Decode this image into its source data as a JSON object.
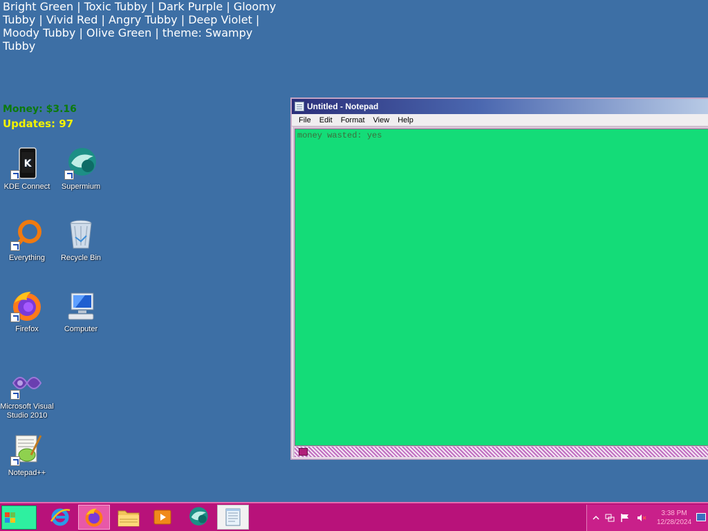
{
  "overlay": {
    "theme_line": "Bright Green | Toxic Tubby | Dark Purple | Gloomy Tubby | Vivid Red | Angry Tubby | Deep Violet | Moody Tubby | Olive Green | theme: Swampy Tubby",
    "money": "Money: $3.16",
    "updates": "Updates: 97"
  },
  "desktop": {
    "icons": [
      {
        "label": "KDE Connect",
        "icon": "kde-connect-icon"
      },
      {
        "label": "Supermium",
        "icon": "supermium-icon"
      },
      {
        "label": "Everything",
        "icon": "everything-icon"
      },
      {
        "label": "Recycle Bin",
        "icon": "recycle-bin-icon"
      },
      {
        "label": "Firefox",
        "icon": "firefox-icon"
      },
      {
        "label": "Computer",
        "icon": "computer-icon"
      },
      {
        "label": "Microsoft Visual Studio 2010",
        "icon": "visual-studio-icon"
      },
      {
        "label": "Notepad++",
        "icon": "notepad-plus-plus-icon"
      }
    ]
  },
  "notepad": {
    "title": "Untitled - Notepad",
    "menu": [
      "File",
      "Edit",
      "Format",
      "View",
      "Help"
    ],
    "content": "money wasted: yes"
  },
  "taskbar": {
    "items": [
      "internet-explorer-icon",
      "firefox-icon",
      "file-explorer-icon",
      "media-player-icon",
      "supermium-icon",
      "notepad-icon"
    ],
    "active": "firefox-icon",
    "clock_time": "3:38 PM",
    "clock_date": "12/28/2024"
  },
  "colors": {
    "desktop_bg": "#3d6fa5",
    "taskbar_bg": "#b8127a",
    "notepad_bg": "#14dc78",
    "money_text": "#0c7a0c",
    "updates_text": "#f2f200"
  }
}
